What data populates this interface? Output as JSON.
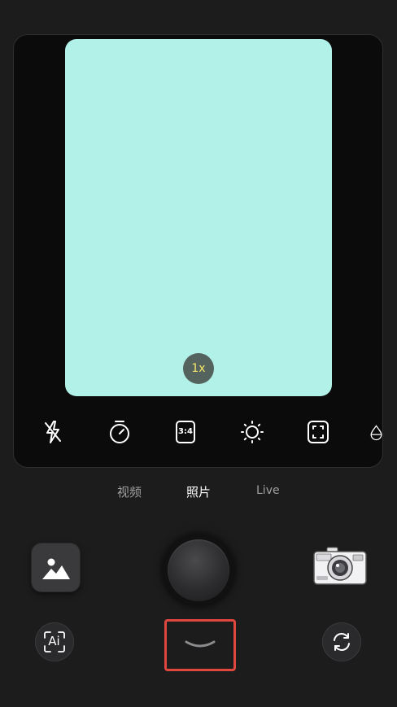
{
  "viewfinder": {
    "zoom_label": "1x",
    "preview_color": "#b2f1e8"
  },
  "toolbar": {
    "aspect_ratio_label": "3:4",
    "icons": [
      "flash-off-icon",
      "timer-icon",
      "aspect-ratio-icon",
      "brightness-icon",
      "focus-frame-icon",
      "partial-icon"
    ]
  },
  "modes": {
    "items": [
      {
        "label": "视频"
      },
      {
        "label": "照片"
      },
      {
        "label": "Live"
      }
    ],
    "active": "照片"
  },
  "controls": {
    "gallery": "gallery-icon",
    "shutter": "shutter",
    "camera_sticker": "retro-camera-icon",
    "ai_label": "Ai",
    "flip": "switch-camera-icon",
    "collapse": "chevron-down-icon"
  },
  "colors": {
    "background": "#1c1c1d",
    "highlight": "#e0483f",
    "zoom_text": "#f4e46a"
  }
}
